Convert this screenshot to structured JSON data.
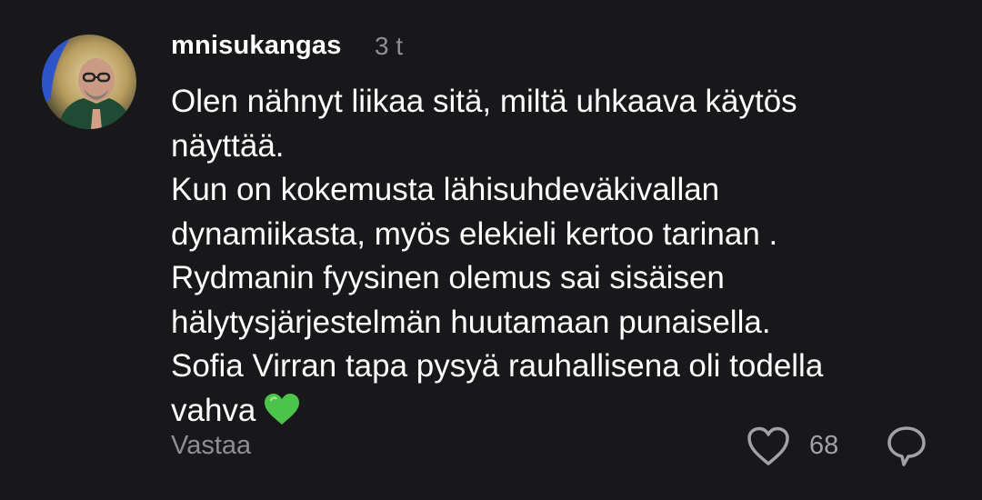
{
  "comment": {
    "username": "mnisukangas",
    "time": "3 t",
    "avatar_icon": "user-avatar-icon",
    "lines": [
      "Olen nähnyt liikaa sitä, miltä uhkaava käytös",
      "näyttää.",
      "Kun on kokemusta lähisuhdeväkivallan",
      "dynamiikasta, myös elekieli kertoo tarinan .",
      "Rydmanin fyysinen olemus sai sisäisen",
      "hälytysjärjestelmän huutamaan punaisella.",
      "Sofia Virran tapa pysyä rauhallisena oli todella",
      "vahva"
    ],
    "emoji": "green-heart-icon",
    "reply_label": "Vastaa",
    "like_count": "68",
    "like_icon": "heart-outline-icon",
    "share_icon": "speech-bubble-icon"
  },
  "colors": {
    "background": "#18181b",
    "text": "#ffffff",
    "muted": "#8e8e93",
    "heart_green": "#4cc44a"
  }
}
